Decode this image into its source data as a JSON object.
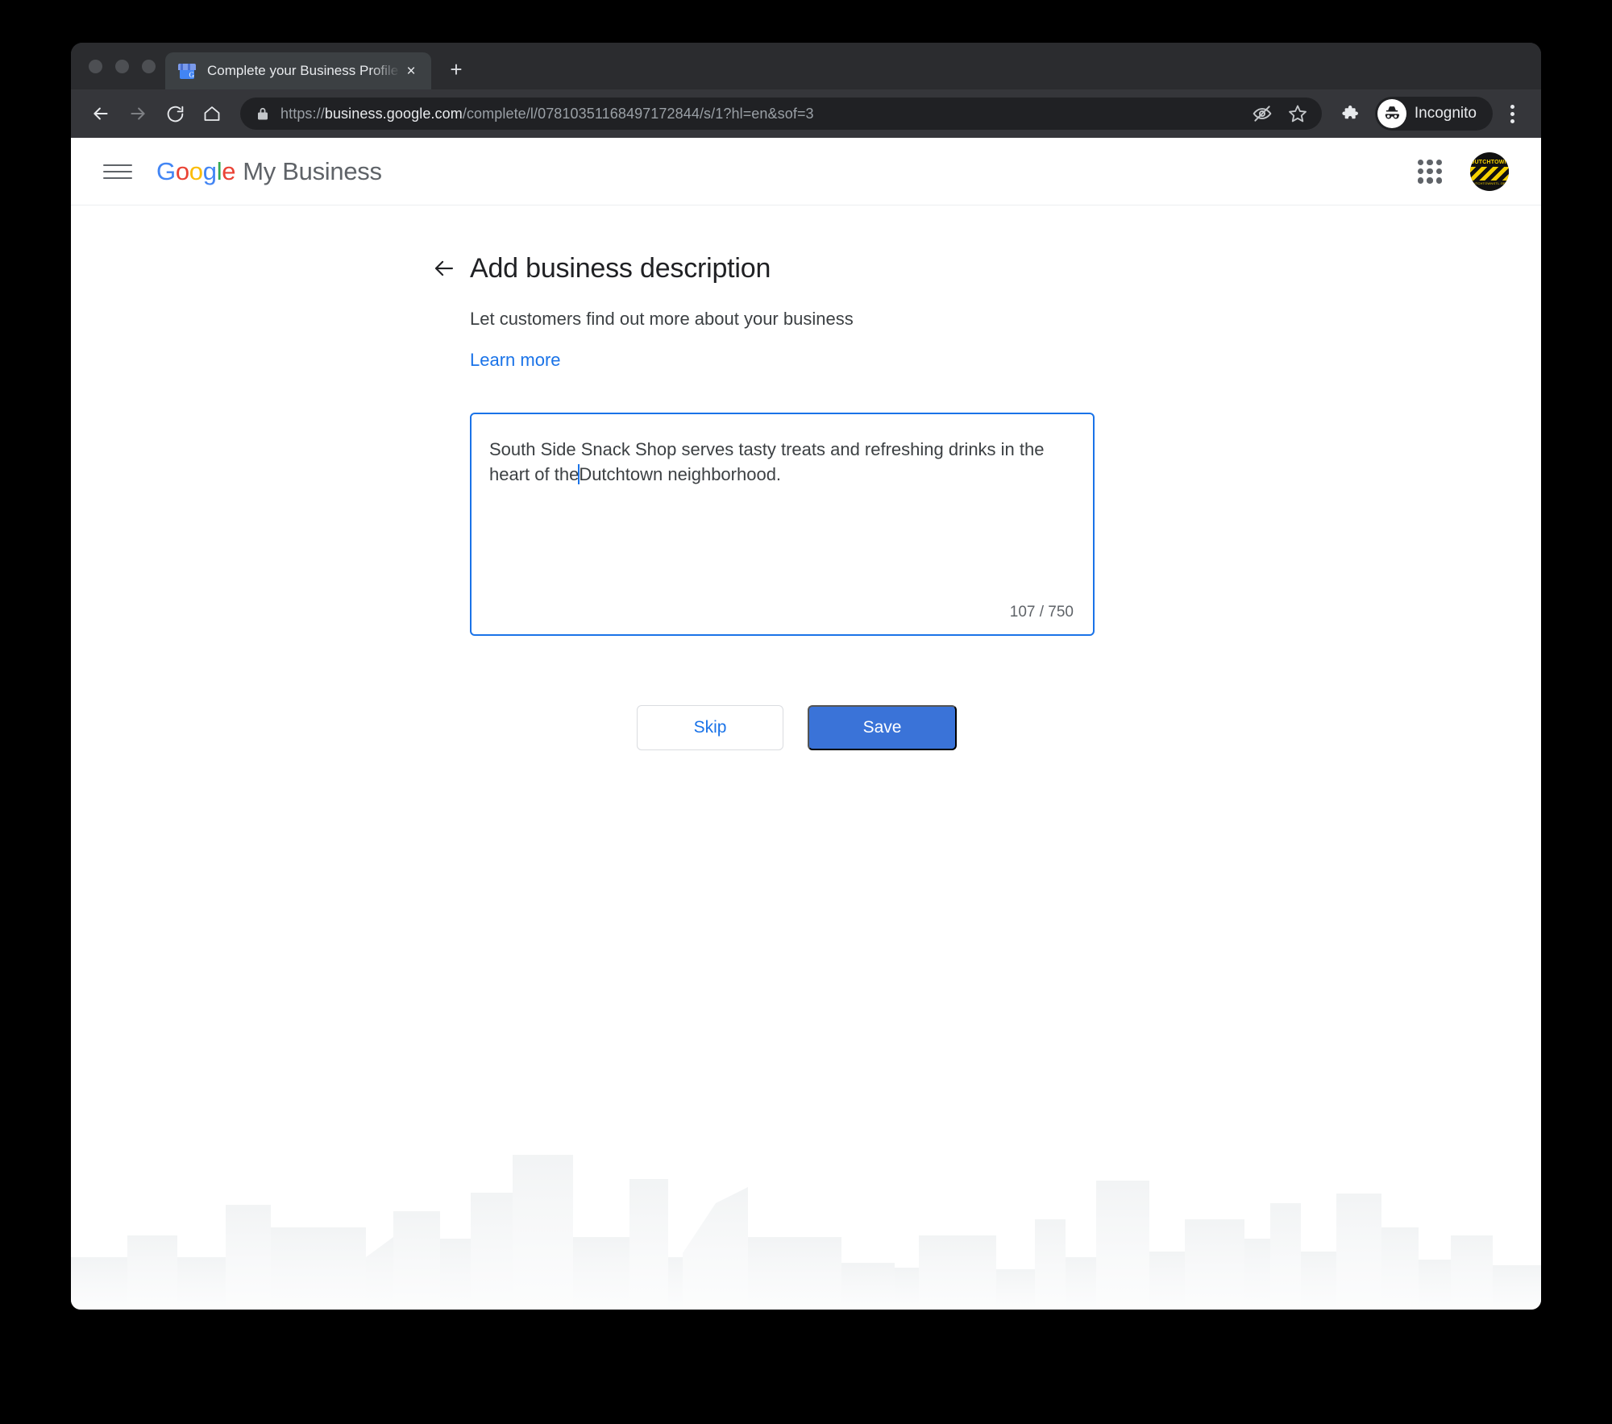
{
  "browser": {
    "tab": {
      "title": "Complete your Business Profile",
      "favicon": "google-my-business-storefront-icon",
      "close_label": "×"
    },
    "new_tab_label": "+",
    "nav": {
      "back": "back-arrow-icon",
      "forward": "forward-arrow-icon",
      "reload": "reload-icon",
      "home": "home-icon"
    },
    "omnibox": {
      "lock": "lock-icon",
      "url_scheme": "https://",
      "url_host": "business.google.com",
      "url_path": "/complete/l/07810351168497172844/s/1?hl=en&sof=3",
      "full_url": "https://business.google.com/complete/l/07810351168497172844/s/1?hl=en&sof=3"
    },
    "actions": {
      "third_party_cookies": "eye-slash-icon",
      "bookmark": "star-icon",
      "extensions": "puzzle-piece-icon",
      "profile_label": "Incognito",
      "profile_avatar": "incognito-hat-glasses-icon",
      "menu": "kebab-menu-icon"
    }
  },
  "app_header": {
    "menu": "hamburger-icon",
    "logo": {
      "letters": [
        "G",
        "o",
        "o",
        "g",
        "l",
        "e"
      ],
      "suffix": "My Business"
    },
    "apps_grid": "apps-grid-icon",
    "avatar": {
      "top_text": "DUTCHTOWN",
      "bottom_text": "DUTCHTOWNSTL.ORG"
    }
  },
  "page": {
    "back": "back-arrow-icon",
    "title": "Add business description",
    "subtitle": "Let customers find out more about your business",
    "learn_more": "Learn more",
    "description": {
      "text_before_caret": "South Side Snack Shop serves tasty treats and refreshing drinks in the heart of the",
      "text_after_caret": "Dutchtown neighborhood.",
      "full_value": "South Side Snack Shop serves tasty treats and refreshing drinks in the heart of the Dutchtown neighborhood.",
      "placeholder": "",
      "char_count": "107 / 750",
      "max_length": 750,
      "current_length": 107
    },
    "buttons": {
      "skip": "Skip",
      "save": "Save"
    }
  },
  "colors": {
    "accent_blue": "#1a73e8",
    "save_button": "#3a73d8",
    "text_primary": "#202124",
    "text_secondary": "#3c4043",
    "skyline": "#f1f3f4"
  }
}
